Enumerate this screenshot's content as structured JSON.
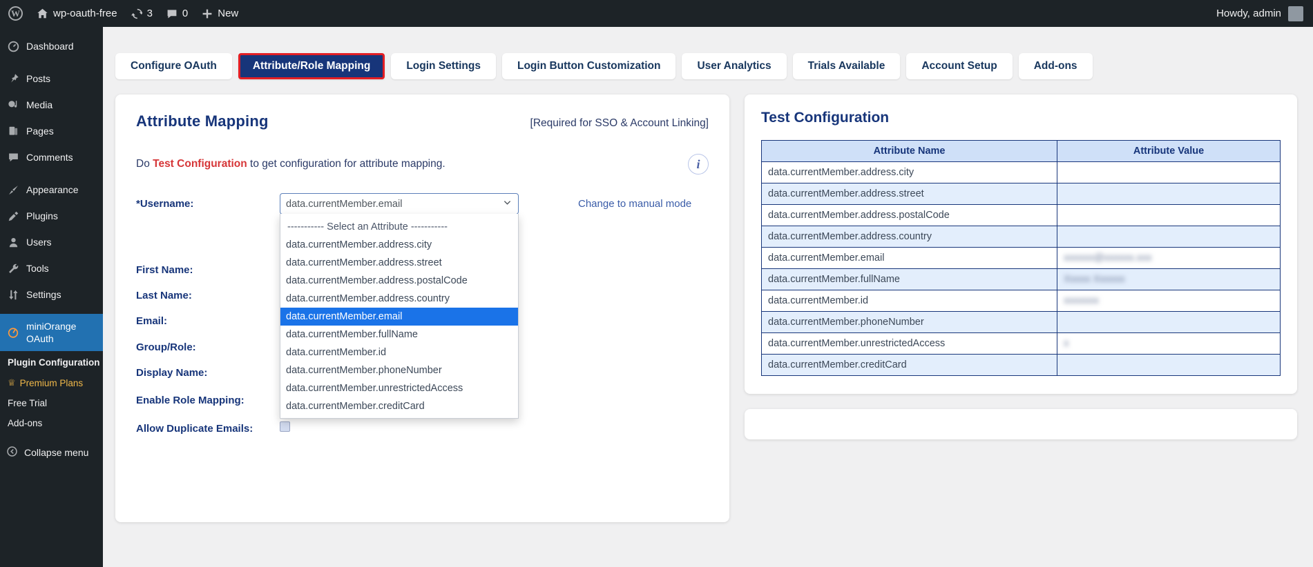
{
  "adminbar": {
    "site_name": "wp-oauth-free",
    "updates_count": "3",
    "comments_count": "0",
    "new_label": "New",
    "howdy": "Howdy, admin"
  },
  "sidebar": {
    "items": [
      {
        "label": "Dashboard",
        "icon": "dashboard-icon"
      },
      {
        "label": "Posts",
        "icon": "pin-icon"
      },
      {
        "label": "Media",
        "icon": "media-icon"
      },
      {
        "label": "Pages",
        "icon": "pages-icon"
      },
      {
        "label": "Comments",
        "icon": "comment-icon"
      },
      {
        "label": "Appearance",
        "icon": "brush-icon"
      },
      {
        "label": "Plugins",
        "icon": "plug-icon"
      },
      {
        "label": "Users",
        "icon": "user-icon"
      },
      {
        "label": "Tools",
        "icon": "wrench-icon"
      },
      {
        "label": "Settings",
        "icon": "sliders-icon"
      }
    ],
    "active_item": {
      "label": "miniOrange OAuth",
      "icon": "miniorange-icon"
    },
    "submenu": [
      {
        "label": "Plugin Configuration",
        "current": true
      },
      {
        "label": "Premium Plans",
        "premium": true
      },
      {
        "label": "Free Trial"
      },
      {
        "label": "Add-ons"
      }
    ],
    "collapse_label": "Collapse menu"
  },
  "tabs": [
    {
      "label": "Configure OAuth",
      "active": false
    },
    {
      "label": "Attribute/Role Mapping",
      "active": true
    },
    {
      "label": "Login Settings",
      "active": false
    },
    {
      "label": "Login Button Customization",
      "active": false
    },
    {
      "label": "User Analytics",
      "active": false
    },
    {
      "label": "Trials Available",
      "active": false
    },
    {
      "label": "Account Setup",
      "active": false
    },
    {
      "label": "Add-ons",
      "active": false
    }
  ],
  "attribute_mapping": {
    "title": "Attribute Mapping",
    "required_note": "[Required for SSO & Account Linking]",
    "instruction_prefix": "Do ",
    "instruction_link": "Test Configuration",
    "instruction_suffix": " to get configuration for attribute mapping.",
    "info_icon_label": "i",
    "username_label": "*Username:",
    "username_value": "data.currentMember.email",
    "manual_mode_link": "Change to manual mode",
    "rows": [
      {
        "label": "First Name:"
      },
      {
        "label": "Last Name:"
      },
      {
        "label": "Email:"
      },
      {
        "label": "Group/Role:"
      },
      {
        "label": "Display Name:"
      }
    ],
    "checkboxes": [
      {
        "label": "Enable Role Mapping:",
        "checked": true
      },
      {
        "label": "Allow Duplicate Emails:",
        "checked": false
      }
    ],
    "dropdown_options": [
      "----------- Select an Attribute -----------",
      "data.currentMember.address.city",
      "data.currentMember.address.street",
      "data.currentMember.address.postalCode",
      "data.currentMember.address.country",
      "data.currentMember.email",
      "data.currentMember.fullName",
      "data.currentMember.id",
      "data.currentMember.phoneNumber",
      "data.currentMember.unrestrictedAccess",
      "data.currentMember.creditCard"
    ],
    "dropdown_selected_index": 5
  },
  "test_configuration": {
    "title": "Test Configuration",
    "columns": [
      "Attribute Name",
      "Attribute Value"
    ],
    "rows": [
      {
        "name": "data.currentMember.address.city",
        "value": "",
        "blurred": false
      },
      {
        "name": "data.currentMember.address.street",
        "value": "",
        "blurred": false
      },
      {
        "name": "data.currentMember.address.postalCode",
        "value": "",
        "blurred": false
      },
      {
        "name": "data.currentMember.address.country",
        "value": "",
        "blurred": false
      },
      {
        "name": "data.currentMember.email",
        "value": "xxxxxx@xxxxxx.xxx",
        "blurred": true
      },
      {
        "name": "data.currentMember.fullName",
        "value": "Xxxxx Xxxxxx",
        "blurred": true
      },
      {
        "name": "data.currentMember.id",
        "value": "xxxxxxx",
        "blurred": true
      },
      {
        "name": "data.currentMember.phoneNumber",
        "value": "",
        "blurred": false
      },
      {
        "name": "data.currentMember.unrestrictedAccess",
        "value": "x",
        "blurred": true
      },
      {
        "name": "data.currentMember.creditCard",
        "value": "",
        "blurred": false
      }
    ]
  },
  "colors": {
    "accent_navy": "#17357a",
    "active_tab_border": "#e31e24",
    "wp_blue": "#2271b1",
    "dropdown_highlight": "#1a73e8",
    "link_red": "#d63638"
  }
}
